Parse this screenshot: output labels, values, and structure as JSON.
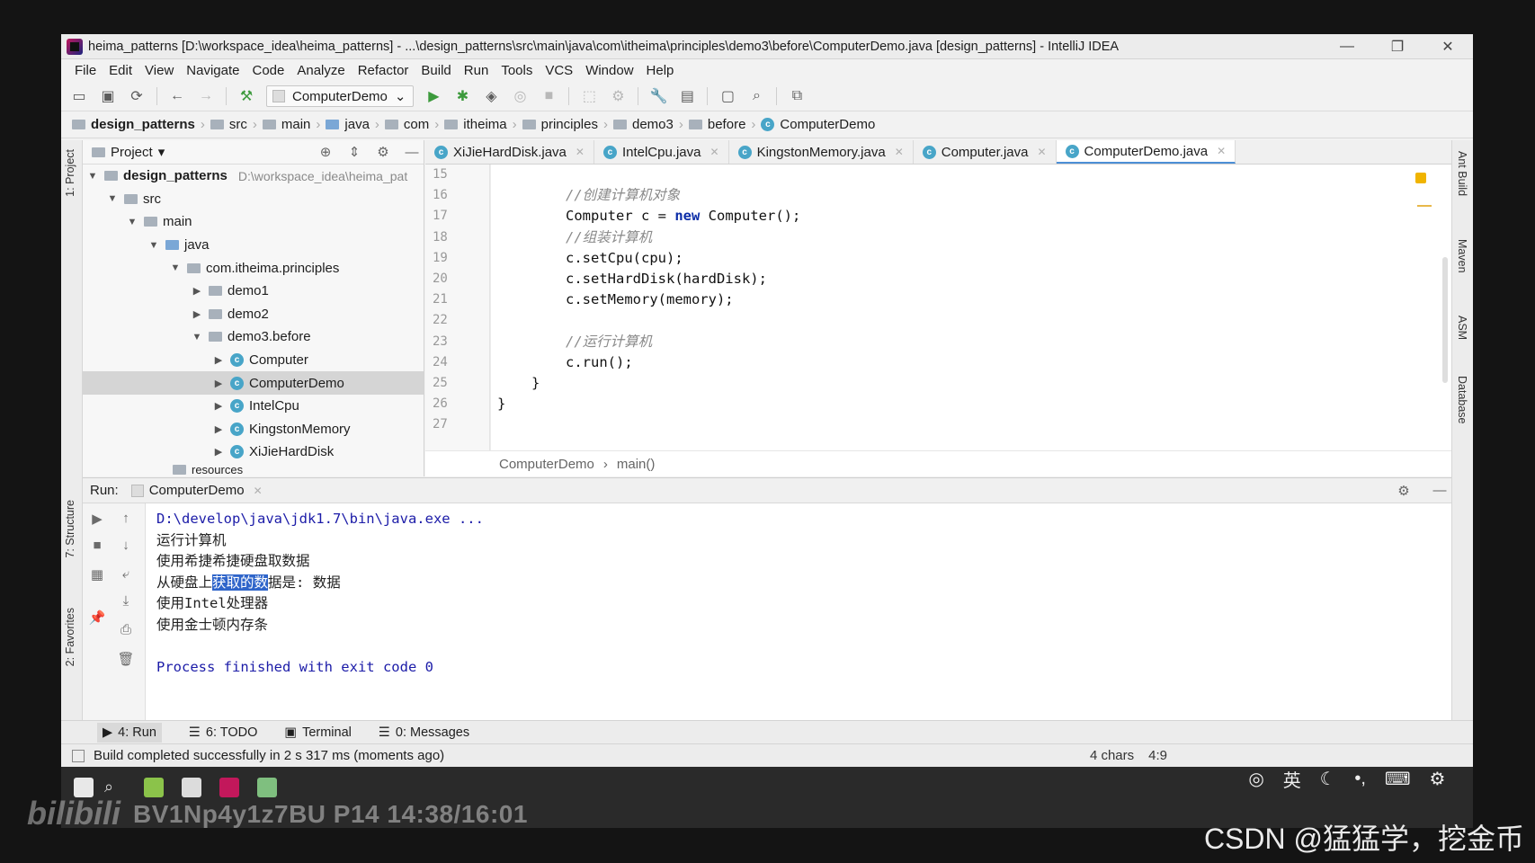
{
  "window": {
    "title": "heima_patterns [D:\\workspace_idea\\heima_patterns] - ...\\design_patterns\\src\\main\\java\\com\\itheima\\principles\\demo3\\before\\ComputerDemo.java [design_patterns] - IntelliJ IDEA",
    "controls": [
      "—",
      "❐",
      "✕"
    ]
  },
  "menu": [
    "File",
    "Edit",
    "View",
    "Navigate",
    "Code",
    "Analyze",
    "Refactor",
    "Build",
    "Run",
    "Tools",
    "VCS",
    "Window",
    "Help"
  ],
  "toolbar": {
    "run_config": "ComputerDemo"
  },
  "breadcrumb": [
    "design_patterns",
    "src",
    "main",
    "java",
    "com",
    "itheima",
    "principles",
    "demo3",
    "before",
    "ComputerDemo"
  ],
  "project_panel": {
    "title": "Project",
    "root_name": "design_patterns",
    "root_path": "D:\\workspace_idea\\heima_pat",
    "tree": [
      "src",
      "main",
      "java",
      "com.itheima.principles",
      "demo1",
      "demo2",
      "demo3.before",
      "Computer",
      "ComputerDemo",
      "IntelCpu",
      "KingstonMemory",
      "XiJieHardDisk",
      "resources"
    ]
  },
  "editor": {
    "tabs": [
      "XiJieHardDisk.java",
      "IntelCpu.java",
      "KingstonMemory.java",
      "Computer.java",
      "ComputerDemo.java"
    ],
    "active_tab": "ComputerDemo.java",
    "line_numbers": [
      "15",
      "16",
      "17",
      "18",
      "19",
      "20",
      "21",
      "22",
      "23",
      "24",
      "25",
      "26",
      "27"
    ],
    "code": {
      "l16": "//创建计算机对象",
      "l17a": "Computer c = ",
      "l17kw": "new",
      "l17b": " Computer();",
      "l18": "//组装计算机",
      "l19": "c.setCpu(cpu);",
      "l20": "c.setHardDisk(hardDisk);",
      "l21": "c.setMemory(memory);",
      "l23": "//运行计算机",
      "l24": "c.run();",
      "l25": "}",
      "l26": "}"
    },
    "bottom_breadcrumb": [
      "ComputerDemo",
      "main()"
    ]
  },
  "run_panel": {
    "label": "Run:",
    "tab": "ComputerDemo",
    "console": {
      "cmd": "D:\\develop\\java\\jdk1.7\\bin\\java.exe ...",
      "out1": "运行计算机",
      "out2": "使用希捷希捷硬盘取数据",
      "out3_pre": "从硬盘上",
      "out3_sel": "获取的数",
      "out3_post": "据是: 数据",
      "out4": "使用Intel处理器",
      "out5": "使用金士顿内存条",
      "exit": "Process finished with exit code 0"
    }
  },
  "side_tabs": {
    "left": [
      "1: Project",
      "7: Structure",
      "2: Favorites"
    ],
    "right": [
      "Ant Build",
      "Maven",
      "ASM",
      "Database"
    ]
  },
  "bottom_tabs": [
    "4: Run",
    "6: TODO",
    "Terminal",
    "0: Messages"
  ],
  "status": {
    "message": "Build completed successfully in 2 s 317 ms (moments ago)",
    "chars": "4 chars",
    "position": "4:9"
  },
  "overlay": {
    "bilibili": "bilibili",
    "video_id": "BV1Np4y1z7BU P14 14:38/16:01",
    "watermark": "CSDN @猛猛学，挖金币"
  }
}
